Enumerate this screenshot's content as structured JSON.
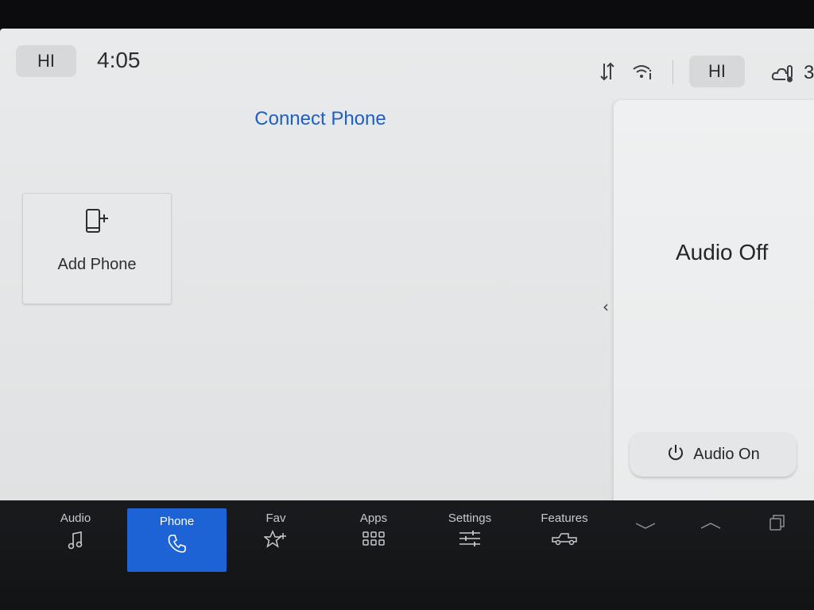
{
  "status_bar": {
    "left_climate": "HI",
    "time": "4:05",
    "right_climate": "HI",
    "outside_temp": "3"
  },
  "main": {
    "title": "Connect Phone",
    "add_phone_label": "Add Phone"
  },
  "audio_panel": {
    "status_text": "Audio Off",
    "audio_on_label": "Audio On"
  },
  "nav": {
    "items": [
      {
        "label": "Audio",
        "icon": "music-note-icon"
      },
      {
        "label": "Phone",
        "icon": "phone-handset-icon"
      },
      {
        "label": "Fav",
        "icon": "star-plus-icon"
      },
      {
        "label": "Apps",
        "icon": "grid-icon"
      },
      {
        "label": "Settings",
        "icon": "sliders-icon"
      },
      {
        "label": "Features",
        "icon": "truck-icon"
      }
    ],
    "active": "Phone"
  },
  "colors": {
    "accent": "#1e63d6",
    "title_blue": "#1f5fc4",
    "screen_bg": "#e6e8e9",
    "nav_bg": "#16171a"
  }
}
